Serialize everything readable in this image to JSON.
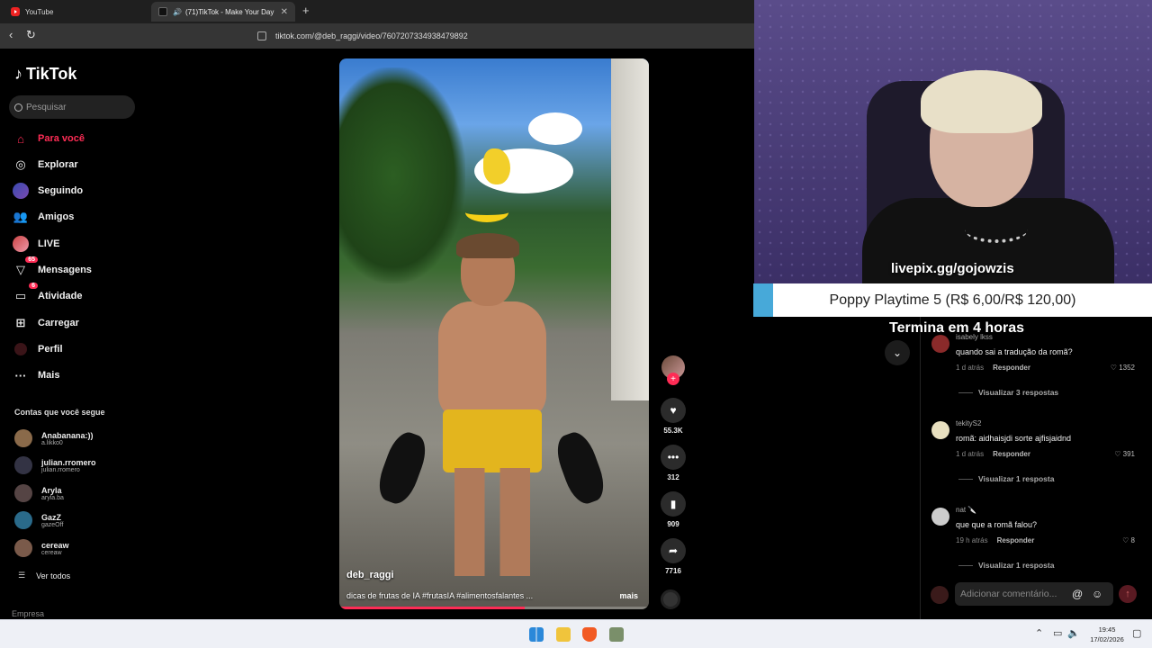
{
  "browser": {
    "tabs": [
      {
        "label": "YouTube",
        "active": false
      },
      {
        "label": "(71)TikTok - Make Your Day",
        "active": true
      }
    ],
    "url": "tiktok.com/@deb_raggi/video/7607207334938479892"
  },
  "tiktok": {
    "logo": "TikTok",
    "search_placeholder": "Pesquisar",
    "menu": [
      {
        "label": "Para você",
        "icon": "home-icon",
        "active": true
      },
      {
        "label": "Explorar",
        "icon": "compass-icon"
      },
      {
        "label": "Seguindo",
        "icon": "following-icon"
      },
      {
        "label": "Amigos",
        "icon": "friends-icon"
      },
      {
        "label": "LIVE",
        "icon": "live-icon"
      },
      {
        "label": "Mensagens",
        "icon": "messages-icon",
        "badge": "65"
      },
      {
        "label": "Atividade",
        "icon": "activity-icon",
        "badge": "6"
      },
      {
        "label": "Carregar",
        "icon": "upload-icon"
      },
      {
        "label": "Perfil",
        "icon": "profile-icon"
      },
      {
        "label": "Mais",
        "icon": "more-icon"
      }
    ],
    "following_title": "Contas que você segue",
    "following": [
      {
        "name": "Anabanana:))",
        "handle": "a.likko0",
        "color": "#8a6a4a"
      },
      {
        "name": "julian.rromero",
        "handle": "julian.rromero",
        "color": "#333344"
      },
      {
        "name": "Aryla",
        "handle": "aryla.ba",
        "color": "#554444"
      },
      {
        "name": "GazZ",
        "handle": "gazeOff",
        "color": "#2a6a8a"
      },
      {
        "name": "cereaw",
        "handle": "cereaw",
        "color": "#7a5a4a"
      }
    ],
    "see_all": "Ver todos",
    "footer": "Empresa"
  },
  "video": {
    "author": "deb_raggi",
    "caption": "dicas de frutas de IA  #frutasIA #alimentosfalantes ...",
    "more": "mais",
    "progress": 0.6
  },
  "actions": {
    "likes": "55.3K",
    "comments": "312",
    "saves": "909",
    "shares": "7716"
  },
  "stream": {
    "livepix": "livepix.gg/gojowzis",
    "goal": "Poppy Playtime 5 (R$ 6,00/R$ 120,00)",
    "goal_progress": 0.05,
    "ends": "Termina em 4 horas"
  },
  "comments": [
    {
      "user": "isabely lkss",
      "text": "quando sai a tradução da romã?",
      "time": "1 d atrás",
      "reply": "Responder",
      "likes": "1352",
      "view": "Visualizar 3 respostas",
      "color": "#8a2a2a"
    },
    {
      "user": "tekityS2",
      "text": "romã: aidhaisjdi sorte ajfisjaidnd",
      "time": "1 d atrás",
      "reply": "Responder",
      "likes": "391",
      "view": "Visualizar 1 resposta",
      "color": "#e8e0c0"
    },
    {
      "user": "nat 🔪",
      "text": "que que a romã falou?",
      "time": "19 h atrás",
      "reply": "Responder",
      "likes": "8",
      "view": "Visualizar 1 resposta",
      "color": "#cccccc"
    }
  ],
  "comment_input_placeholder": "Adicionar comentário...",
  "taskbar": {
    "time": "19:45",
    "date": "17/02/2026"
  }
}
